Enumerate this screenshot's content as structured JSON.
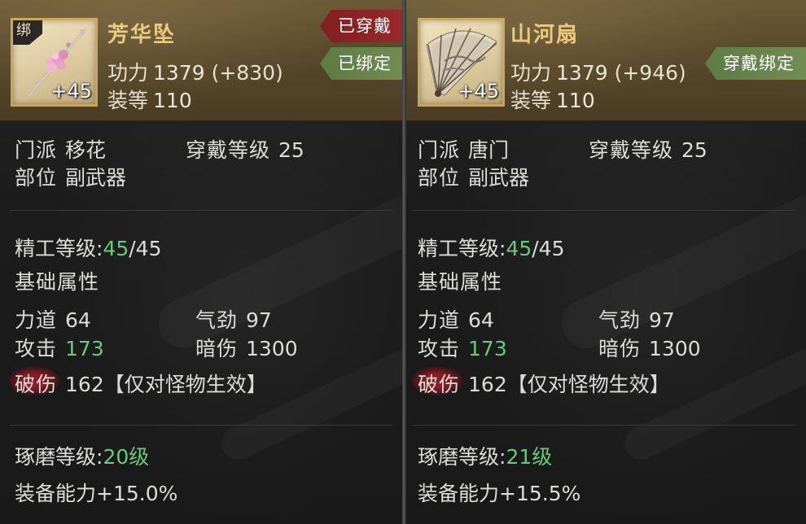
{
  "items": [
    {
      "name": "芳华坠",
      "bind_tag": "绑",
      "level_badge": "+45",
      "power_label": "功力",
      "power_value": "1379",
      "power_bonus": "(+830)",
      "gear_label": "装等",
      "gear_value": "110",
      "ribbons": [
        {
          "text": "已穿戴",
          "color": "red"
        },
        {
          "text": "已绑定",
          "color": "green"
        }
      ],
      "sect_label": "门派",
      "sect_value": "移花",
      "wear_level_label": "穿戴等级",
      "wear_level_value": "25",
      "slot_label": "部位",
      "slot_value": "副武器",
      "refine_label": "精工等级:",
      "refine_current": "45",
      "refine_max": "/45",
      "base_attr_title": "基础属性",
      "str_label": "力道",
      "str_value": "64",
      "qi_label": "气劲",
      "qi_value": "97",
      "atk_label": "攻击",
      "atk_value": "173",
      "dark_label": "暗伤",
      "dark_value": "1300",
      "break_label": "破伤",
      "break_value": "162",
      "break_note": "【仅对怪物生效】",
      "polish_label": "琢磨等级:",
      "polish_value": "20级",
      "ability_label": "装备能力",
      "ability_value": "+15.0%"
    },
    {
      "name": "山河扇",
      "bind_tag": "",
      "level_badge": "+45",
      "power_label": "功力",
      "power_value": "1379",
      "power_bonus": "(+946)",
      "gear_label": "装等",
      "gear_value": "110",
      "ribbons": [
        {
          "text": "穿戴绑定",
          "color": "green"
        }
      ],
      "sect_label": "门派",
      "sect_value": "唐门",
      "wear_level_label": "穿戴等级",
      "wear_level_value": "25",
      "slot_label": "部位",
      "slot_value": "副武器",
      "refine_label": "精工等级:",
      "refine_current": "45",
      "refine_max": "/45",
      "base_attr_title": "基础属性",
      "str_label": "力道",
      "str_value": "64",
      "qi_label": "气劲",
      "qi_value": "97",
      "atk_label": "攻击",
      "atk_value": "173",
      "dark_label": "暗伤",
      "dark_value": "1300",
      "break_label": "破伤",
      "break_value": "162",
      "break_note": "【仅对怪物生效】",
      "polish_label": "琢磨等级:",
      "polish_value": "21级",
      "ability_label": "装备能力",
      "ability_value": "+15.5%"
    }
  ],
  "colors": {
    "header_gold": "#6b5a36",
    "name_gold": "#e9c77a",
    "value_green": "#69c97a",
    "ribbon_red": "#9a2a2a",
    "ribbon_green": "#718d53"
  },
  "icons": [
    "hairpin-icon",
    "fan-icon"
  ]
}
